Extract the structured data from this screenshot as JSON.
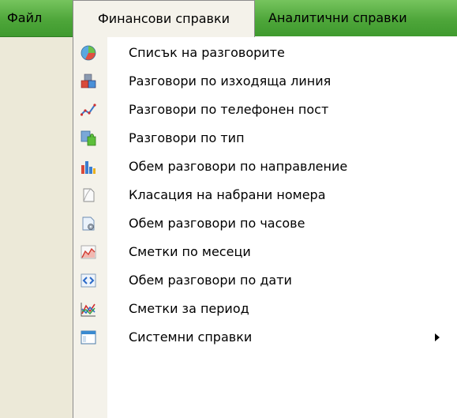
{
  "menubar": {
    "file": "Файл",
    "financial": "Финансови справки",
    "analytic": "Аналитични справки"
  },
  "menu": {
    "items": [
      {
        "label": "Списък на разговорите",
        "icon": "pie-chart-icon"
      },
      {
        "label": "Разговори по изходяща линия",
        "icon": "cubes-icon"
      },
      {
        "label": "Разговори по телефонен пост",
        "icon": "line-graph-icon"
      },
      {
        "label": "Разговори по тип",
        "icon": "puzzle-icon"
      },
      {
        "label": "Обем разговори по направление",
        "icon": "bar-chart-icon"
      },
      {
        "label": "Класация на набрани номера",
        "icon": "document-curl-icon"
      },
      {
        "label": "Обем разговори по часове",
        "icon": "document-gear-icon"
      },
      {
        "label": "Сметки по месеци",
        "icon": "area-chart-icon"
      },
      {
        "label": "Обем разговори по дати",
        "icon": "code-window-icon"
      },
      {
        "label": "Сметки за период",
        "icon": "multi-line-chart-icon"
      },
      {
        "label": "Системни справки",
        "icon": "window-icon",
        "has_submenu": true
      }
    ]
  },
  "colors": {
    "menubar_green": "#4ea63a",
    "icon_strip": "#f4f2ea",
    "workspace": "#ece9d8"
  }
}
